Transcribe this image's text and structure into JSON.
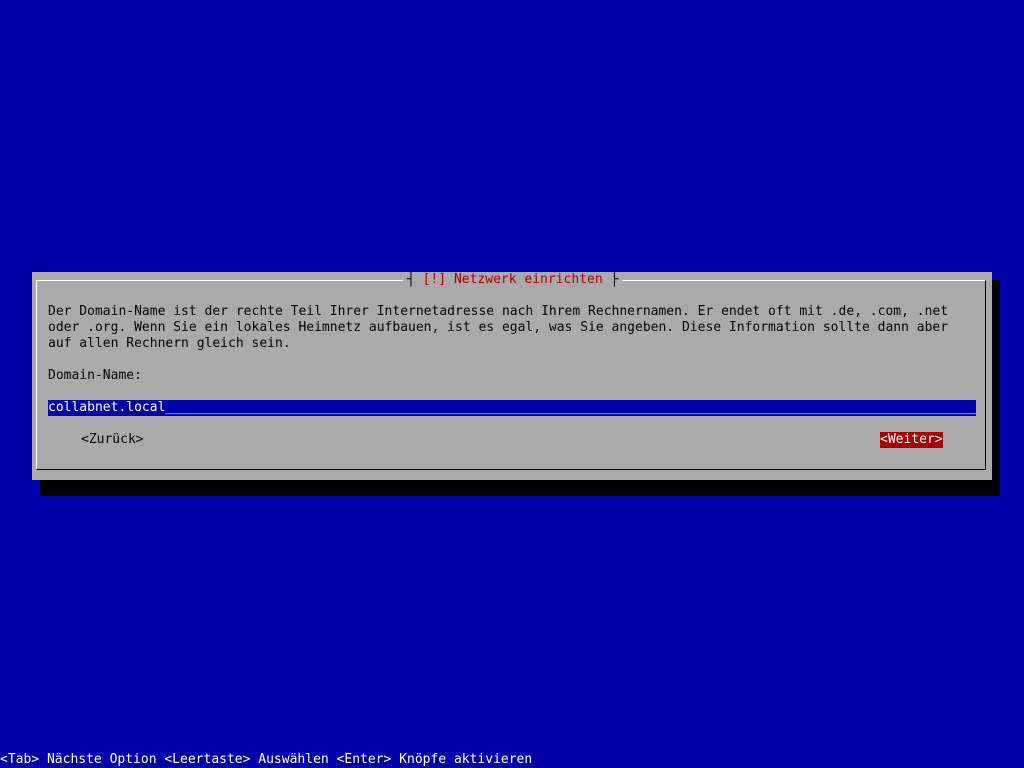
{
  "dialog": {
    "title": "[!] Netzwerk einrichten",
    "body_lines": [
      "Der Domain-Name ist der rechte Teil Ihrer Internetadresse nach Ihrem Rechnernamen. Er endet oft mit .de, .com, .net",
      "oder .org. Wenn Sie ein lokales Heimnetz aufbauen, ist es egal, was Sie angeben. Diese Information sollte dann aber",
      "auf allen Rechnern gleich sein."
    ],
    "field_label": "Domain-Name:",
    "field_value": "collabnet.local",
    "back_button": "<Zurück>",
    "next_button": "<Weiter>"
  },
  "statusline": "<Tab> Nächste Option <Leertaste> Auswählen <Enter> Knöpfe aktivieren",
  "colors": {
    "background": "#0000a8",
    "dialog": "#aaaaaa",
    "title": "#a80000",
    "selected_button": "#a80000",
    "input_background": "#0000a8"
  }
}
